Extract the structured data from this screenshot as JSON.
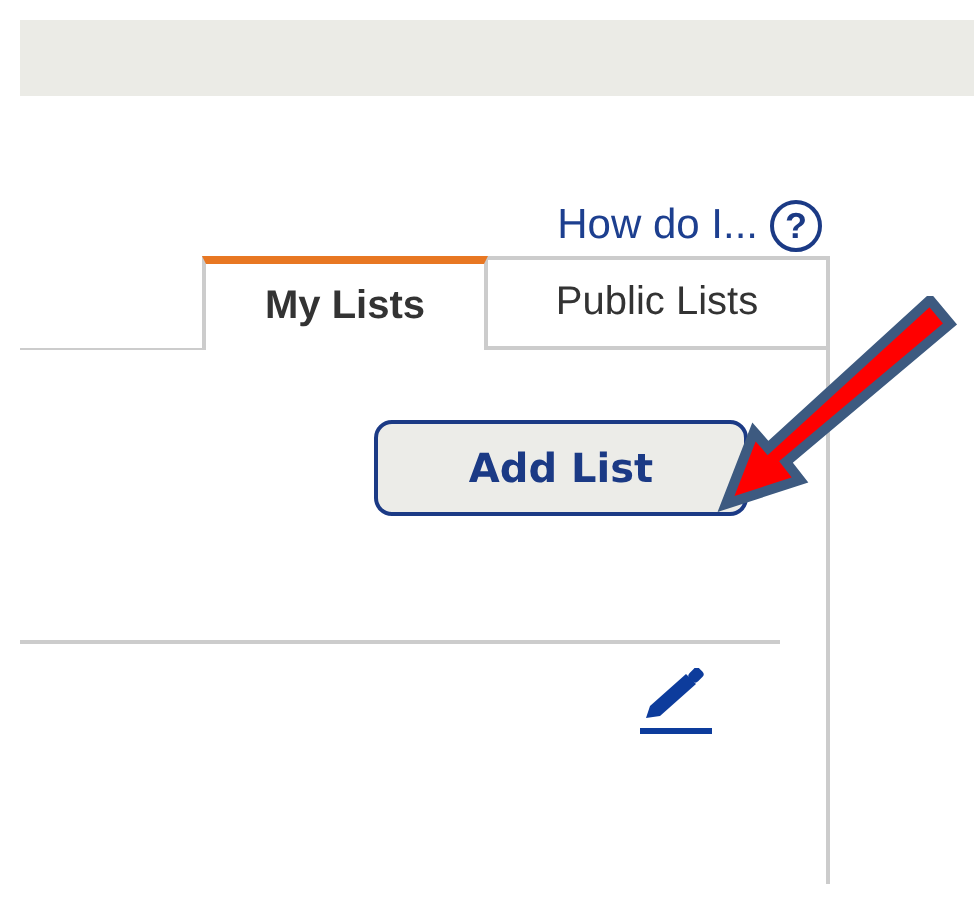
{
  "help_link": {
    "label": "How do I...",
    "icon_text": "?"
  },
  "tabs": [
    {
      "label": "My Lists",
      "selected": true
    },
    {
      "label": "Public Lists",
      "selected": false
    }
  ],
  "add_button": {
    "label": "Add List"
  }
}
